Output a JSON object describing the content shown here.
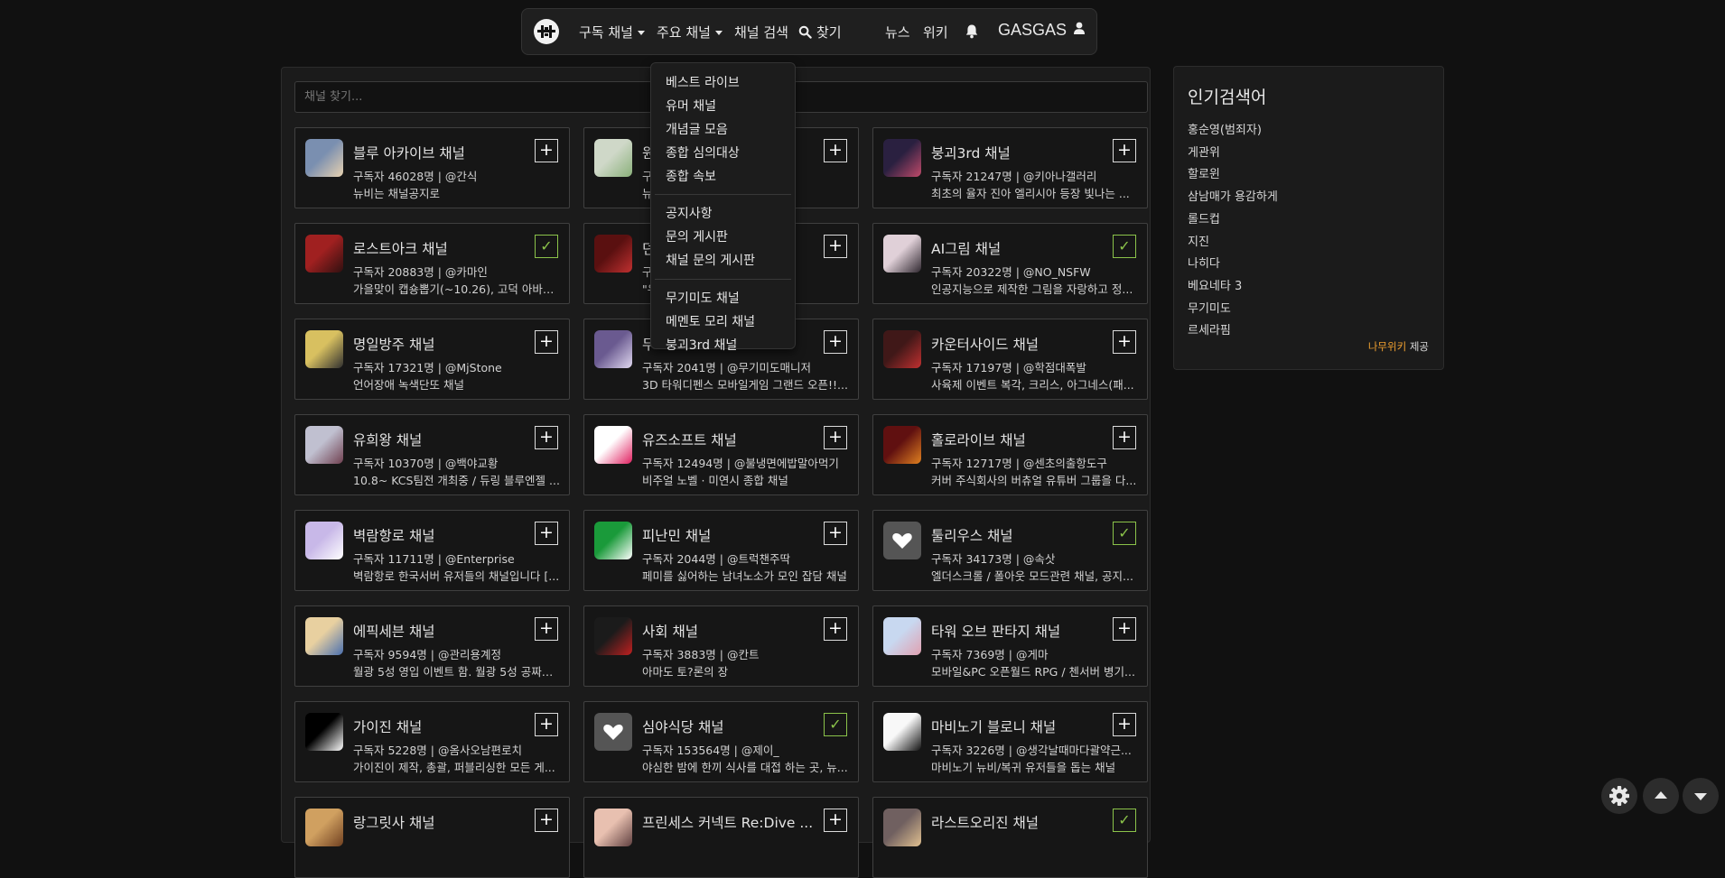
{
  "nav": {
    "subscribed": "구독 채널",
    "main": "주요 채널",
    "channel_search": "채널 검색",
    "find": "찾기",
    "news": "뉴스",
    "wiki": "위키",
    "username": "GASGAS"
  },
  "search": {
    "placeholder": "채널 찾기..."
  },
  "dropdown": {
    "group1": [
      "베스트 라이브",
      "유머 채널",
      "개념글 모음",
      "종합 심의대상",
      "종합 속보"
    ],
    "group2": [
      "공지사항",
      "문의 게시판",
      "채널 문의 게시판"
    ],
    "group3": [
      "무기미도 채널",
      "메멘토 모리 채널",
      "붕괴3rd 채널"
    ]
  },
  "cards": [
    {
      "name": "블루 아카이브 채널",
      "meta": "구독자 46028명 | @간식",
      "desc": "뉴비는 채널공지로",
      "subscribed": false
    },
    {
      "name": "원",
      "meta": "구",
      "desc": "뉴",
      "subscribed": false
    },
    {
      "name": "붕괴3rd 채널",
      "meta": "구독자 21247명 | @키아나갤러리",
      "desc": "최초의 율자 진아 엘리시아 등장 빛나는 ...",
      "subscribed": false
    },
    {
      "name": "로스트아크 채널",
      "meta": "구독자 20883명 | @카마인",
      "desc": "가을맞이 캡숑뽑기(~10.26), 고덕 아바타...",
      "subscribed": true
    },
    {
      "name": "던",
      "meta": "구",
      "desc": "\"우",
      "subscribed": false
    },
    {
      "name": "AI그림 채널",
      "meta": "구독자 20322명 | @NO_NSFW",
      "desc": "인공지능으로 제작한 그림을 자랑하고 정...",
      "subscribed": true
    },
    {
      "name": "명일방주 채널",
      "meta": "구독자 17321명 | @MjStone",
      "desc": "언어장애 녹색단또 채널",
      "subscribed": false
    },
    {
      "name": "무",
      "meta": "구독자 2041명 | @무기미도매니저",
      "desc": "3D 타워디펜스 모바일게임 그랜드 오픈!!...",
      "subscribed": false
    },
    {
      "name": "카운터사이드 채널",
      "meta": "구독자 17197명 | @학점대폭발",
      "desc": "사육제 이벤트 복각, 크리스, 아그네스(패...",
      "subscribed": false
    },
    {
      "name": "유희왕 채널",
      "meta": "구독자 10370명 | @백야교황",
      "desc": "10.8~ KCS팀전 개최중 / 듀링 블루엔젤 ...",
      "subscribed": false
    },
    {
      "name": "유즈소프트 채널",
      "meta": "구독자 12494명 | @불냉면에밥말아먹기",
      "desc": "비주얼 노벨 · 미연시 종합 채널",
      "subscribed": false
    },
    {
      "name": "홀로라이브 채널",
      "meta": "구독자 12717명 | @센초의출항도구",
      "desc": "커버 주식회사의 버츄얼 유튜버 그룹을 다...",
      "subscribed": false
    },
    {
      "name": "벽람항로 채널",
      "meta": "구독자 11711명 | @Enterprise",
      "desc": "벽람항로 한국서버 유저들의 채널입니다 [...",
      "subscribed": false
    },
    {
      "name": "피난민 채널",
      "meta": "구독자 2044명 | @트럭챈주딱",
      "desc": "페미를 싫어하는 남녀노소가 모인 잡담 채널",
      "subscribed": false
    },
    {
      "name": "툴리우스 채널",
      "meta": "구독자 34173명 | @속삿",
      "desc": "엘더스크롤 / 폴아웃 모드관련 채널, 공지...",
      "subscribed": true
    },
    {
      "name": "에픽세븐 채널",
      "meta": "구독자 9594명 | @관리용계정",
      "desc": "월광 5성 영입 이벤트 함. 월광 5성 공짜로...",
      "subscribed": false
    },
    {
      "name": "사회 채널",
      "meta": "구독자 3883명 | @칸트",
      "desc": "아마도 토?론의 장",
      "subscribed": false
    },
    {
      "name": "타워 오브 판타지 채널",
      "meta": "구독자 7369명 | @게마",
      "desc": "모바일&PC 오픈월드 RPG / 첸서버 병기...",
      "subscribed": false
    },
    {
      "name": "가이진 채널",
      "meta": "구독자 5228명 | @옴사오남편로치",
      "desc": "가이진이 제작, 총괄, 퍼블리싱한 모든 게...",
      "subscribed": false
    },
    {
      "name": "심야식당 채널",
      "meta": "구독자 153564명 | @제이_",
      "desc": "야심한 밤에 한끼 식사를 대접 하는 곳, 뉴...",
      "subscribed": true
    },
    {
      "name": "마비노기 블로니 채널",
      "meta": "구독자 3226명 | @생각날때마다괄약근...",
      "desc": "마비노기 뉴비/복귀 유저들을 돕는 채널",
      "subscribed": false
    },
    {
      "name": "랑그릿사 채널",
      "meta": "",
      "desc": "",
      "subscribed": false
    },
    {
      "name": "프린세스 커넥트 Re:Dive ...",
      "meta": "",
      "desc": "",
      "subscribed": false
    },
    {
      "name": "라스트오리진 채널",
      "meta": "",
      "desc": "",
      "subscribed": true
    }
  ],
  "sidebar": {
    "title": "인기검색어",
    "items": [
      "홍순영(범죄자)",
      "게관위",
      "할로윈",
      "삼남매가 용감하게",
      "롤드컵",
      "지진",
      "나히다",
      "베요네타 3",
      "무기미도",
      "르세라핌"
    ],
    "credit_brand": "나무위키",
    "credit_suffix": " 제공"
  },
  "colors": {
    "background": "#111111",
    "panel": "#1b1b1b",
    "check": "#8bc34a",
    "namu": "#f0a030"
  }
}
